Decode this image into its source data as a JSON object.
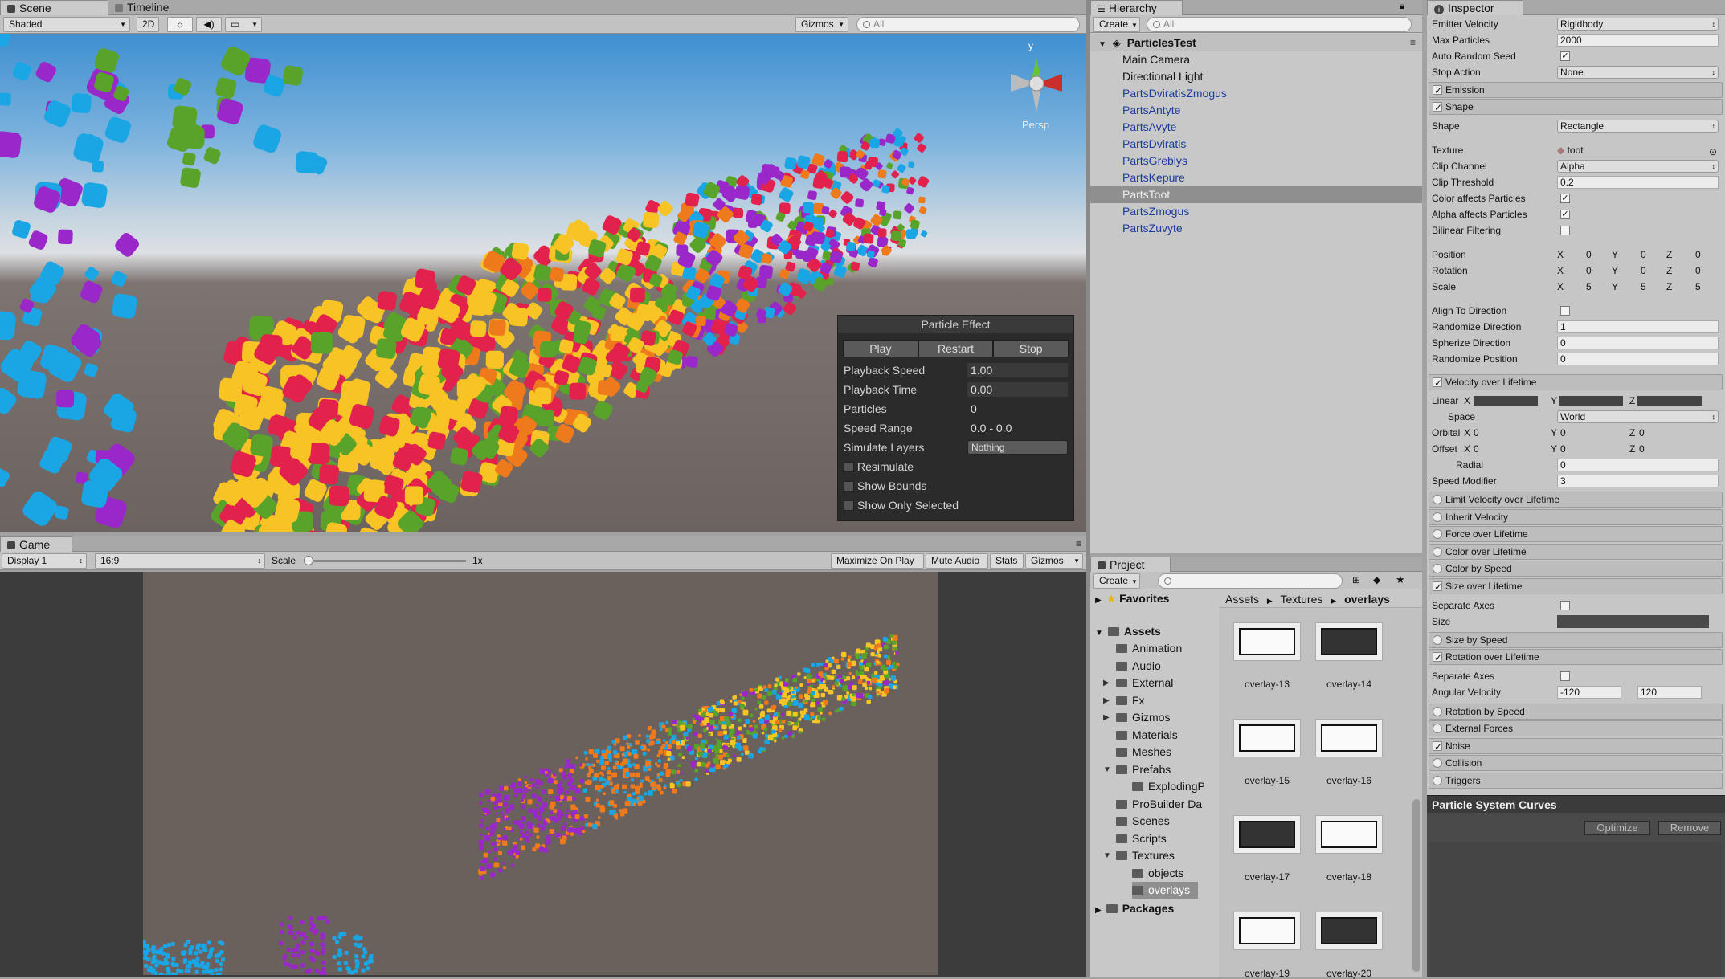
{
  "scene": {
    "tab_label": "Scene",
    "timeline_tab": "Timeline",
    "shading": "Shaded",
    "mode_2d": "2D",
    "gizmos": "Gizmos",
    "search_placeholder": "All",
    "persp_label": "Persp",
    "gizmo_axis": "y"
  },
  "particle_effect": {
    "title": "Particle Effect",
    "buttons": [
      "Play",
      "Restart",
      "Stop"
    ],
    "playback_speed_label": "Playback Speed",
    "playback_speed": "1.00",
    "playback_time_label": "Playback Time",
    "playback_time": "0.00",
    "particles_label": "Particles",
    "particles": "0",
    "speed_range_label": "Speed Range",
    "speed_range": "0.0 - 0.0",
    "simulate_layers_label": "Simulate Layers",
    "simulate_layers": "Nothing",
    "resimulate": "Resimulate",
    "show_bounds": "Show Bounds",
    "show_only_selected": "Show Only Selected"
  },
  "game": {
    "tab_label": "Game",
    "display": "Display 1",
    "aspect": "16:9",
    "scale_label": "Scale",
    "scale_value": "1x",
    "maximize": "Maximize On Play",
    "mute": "Mute Audio",
    "stats": "Stats",
    "gizmos": "Gizmos"
  },
  "hierarchy": {
    "tab_label": "Hierarchy",
    "create": "Create",
    "search_placeholder": "All",
    "scene_name": "ParticlesTest",
    "items": [
      "Main Camera",
      "Directional Light",
      "PartsDviratisZmogus",
      "PartsAntyte",
      "PartsAvyte",
      "PartsDviratis",
      "PartsGreblys",
      "PartsKepure",
      "PartsToot",
      "PartsZmogus",
      "PartsZuvyte"
    ],
    "selected": "PartsToot"
  },
  "project": {
    "tab_label": "Project",
    "create": "Create",
    "favorites": "Favorites",
    "assets": "Assets",
    "folders": [
      "Animation",
      "Audio",
      "External",
      "Fx",
      "Gizmos",
      "Materials",
      "Meshes",
      "Prefabs",
      "ExplodingP",
      "ProBuilder Da",
      "Scenes",
      "Scripts",
      "Textures",
      "objects",
      "overlays"
    ],
    "packages": "Packages",
    "breadcrumb": [
      "Assets",
      "Textures",
      "overlays"
    ],
    "thumbs": [
      "overlay-13",
      "overlay-14",
      "overlay-15",
      "overlay-16",
      "overlay-17",
      "overlay-18",
      "overlay-19",
      "overlay-20"
    ]
  },
  "inspector": {
    "tab_label": "Inspector",
    "emitter_velocity_label": "Emitter Velocity",
    "emitter_velocity": "Rigidbody",
    "max_particles_label": "Max Particles",
    "max_particles": "2000",
    "auto_random_seed_label": "Auto Random Seed",
    "stop_action_label": "Stop Action",
    "stop_action": "None",
    "emission": "Emission",
    "shape": "Shape",
    "shape_label": "Shape",
    "shape_value": "Rectangle",
    "texture_label": "Texture",
    "texture_value": "toot",
    "clip_channel_label": "Clip Channel",
    "clip_channel": "Alpha",
    "clip_threshold_label": "Clip Threshold",
    "clip_threshold": "0.2",
    "color_affects_label": "Color affects Particles",
    "alpha_affects_label": "Alpha affects Particles",
    "bilinear_label": "Bilinear Filtering",
    "position_label": "Position",
    "position": [
      "0",
      "0",
      "0"
    ],
    "rotation_label": "Rotation",
    "rotation": [
      "0",
      "0",
      "0"
    ],
    "scale_label": "Scale",
    "scale": [
      "5",
      "5",
      "5"
    ],
    "align_label": "Align To Direction",
    "randomize_dir_label": "Randomize Direction",
    "randomize_dir": "1",
    "spherize_label": "Spherize Direction",
    "spherize": "0",
    "randomize_pos_label": "Randomize Position",
    "randomize_pos": "0",
    "velocity_module": "Velocity over Lifetime",
    "linear_label": "Linear",
    "space_label": "Space",
    "space_value": "World",
    "orbital_label": "Orbital",
    "orbital": [
      "0",
      "0",
      "0"
    ],
    "offset_label": "Offset",
    "offset": [
      "0",
      "0",
      "0"
    ],
    "radial_label": "Radial",
    "radial": "0",
    "speed_modifier_label": "Speed Modifier",
    "speed_modifier": "3",
    "limit_velocity": "Limit Velocity over Lifetime",
    "inherit_velocity": "Inherit Velocity",
    "force": "Force over Lifetime",
    "color_lifetime": "Color over Lifetime",
    "color_speed": "Color by Speed",
    "size_lifetime": "Size over Lifetime",
    "separate_axes_label": "Separate Axes",
    "size_label": "Size",
    "size_speed": "Size by Speed",
    "rotation_lifetime": "Rotation over Lifetime",
    "angular_label": "Angular Velocity",
    "angular_min": "-120",
    "angular_max": "120",
    "rotation_speed": "Rotation by Speed",
    "external_forces": "External Forces",
    "noise": "Noise",
    "collision": "Collision",
    "triggers": "Triggers",
    "curves_title": "Particle System Curves",
    "optimize": "Optimize",
    "remove": "Remove"
  },
  "colors": {
    "yellow": "#f7c325",
    "red": "#e2214c",
    "green": "#5aa32a",
    "orange": "#ee7a1c",
    "purple": "#9a27c9",
    "cyan": "#1aa6e5",
    "selection": "#8f8f8f"
  }
}
